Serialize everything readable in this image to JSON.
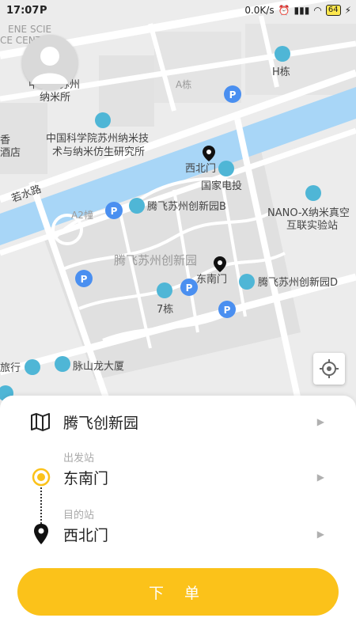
{
  "status_bar": {
    "time": "17:07",
    "notification_icon": "P",
    "network_speed": "0.0K/s",
    "battery": "64"
  },
  "map": {
    "labels": {
      "top_left_partial": "ENE SCIE",
      "center_partial": "CE CENTER",
      "suzhou_nano": "纳米所",
      "suzhou_prefix": "中科院苏州",
      "h_building": "H栋",
      "a_building": "A栋",
      "hotel_partial_1": "香",
      "hotel_partial_2": "酒店",
      "institute_line1": "中国科学院苏州纳米技",
      "institute_line2": "术与纳米仿生研究所",
      "xibeimen_top": "西北门",
      "guojia_diantou": "国家电投",
      "ruoshui_road": "若水路",
      "a2_building": "A2幢",
      "tengfei_b": "腾飞苏州创新园B",
      "nano_x_line1": "NANO-X纳米真空",
      "nano_x_line2": "互联实验站",
      "tengfei_center": "腾飞苏州创新园",
      "dongnanmen_map": "东南门",
      "tengfei_d": "腾飞苏州创新园D",
      "building_7": "7栋",
      "hotel_bottom": "旅行",
      "maishan_longdasha": "脉山龙大厦"
    }
  },
  "sheet": {
    "destination_name": "腾飞创新园",
    "departure_caption": "出发站",
    "departure_station": "东南门",
    "arrival_caption": "目的站",
    "arrival_station": "西北门",
    "order_button": "下 单"
  },
  "colors": {
    "accent": "#fbc21a",
    "water": "#a8d6f7",
    "poi": "#4fb6d6",
    "parking": "#4a8ff0"
  },
  "icons": {
    "map_icon": "folded-map-icon",
    "departure_icon": "yellow-dot-icon",
    "arrival_icon": "black-pin-icon",
    "locate_icon": "crosshair-icon"
  }
}
